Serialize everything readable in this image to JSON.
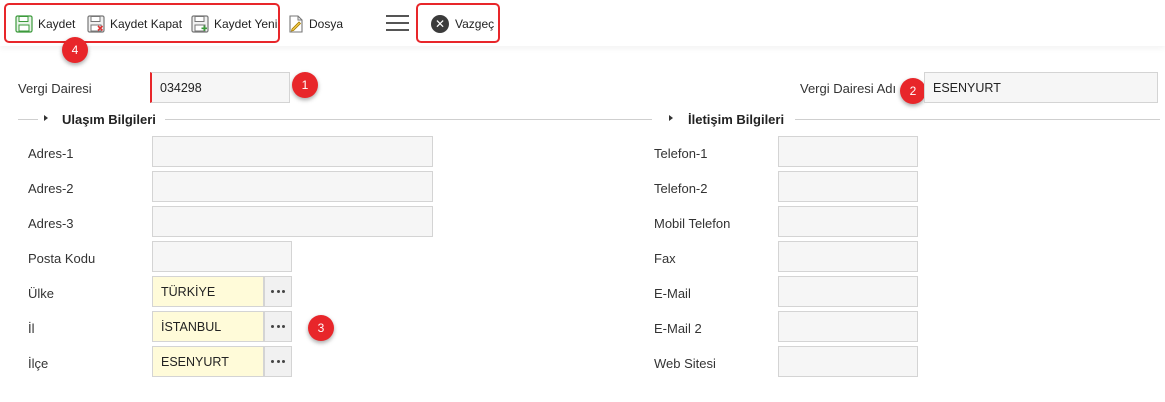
{
  "toolbar": {
    "save_label": "Kaydet",
    "save_close_label": "Kaydet Kapat",
    "save_new_label": "Kaydet Yeni",
    "file_label": "Dosya",
    "cancel_label": "Vazgeç"
  },
  "badges": [
    "1",
    "2",
    "3",
    "4"
  ],
  "header_form": {
    "tax_office_label": "Vergi Dairesi",
    "tax_office_value": "034298",
    "tax_office_name_label": "Vergi Dairesi Adı",
    "tax_office_name_value": "ESENYURT"
  },
  "sections": {
    "address_title": "Ulaşım Bilgileri",
    "contact_title": "İletişim Bilgileri"
  },
  "address": {
    "address1_label": "Adres-1",
    "address1_value": "",
    "address2_label": "Adres-2",
    "address2_value": "",
    "address3_label": "Adres-3",
    "address3_value": "",
    "postal_label": "Posta Kodu",
    "postal_value": "",
    "country_label": "Ülke",
    "country_value": "TÜRKİYE",
    "city_label": "İl",
    "city_value": "İSTANBUL",
    "district_label": "İlçe",
    "district_value": "ESENYURT"
  },
  "contact": {
    "phone1_label": "Telefon-1",
    "phone2_label": "Telefon-2",
    "mobile_label": "Mobil Telefon",
    "fax_label": "Fax",
    "email_label": "E-Mail",
    "email2_label": "E-Mail 2",
    "website_label": "Web Sitesi"
  },
  "colors": {
    "accent_red": "#e8262a",
    "lookup_yellow": "#fffbd9",
    "save_icon_green": "#3c9a3c"
  }
}
